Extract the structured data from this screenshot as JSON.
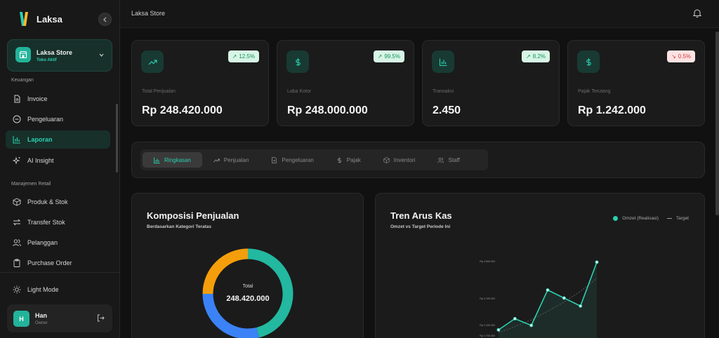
{
  "brand": {
    "name": "Laksa"
  },
  "store": {
    "name": "Laksa Store",
    "subtitle": "Toko Aktif"
  },
  "sidebar": {
    "sections": [
      {
        "label": "Keuangan"
      },
      {
        "label": "Manajemen Retail"
      }
    ],
    "items": [
      {
        "label": "Invoice",
        "icon": "file-text-icon"
      },
      {
        "label": "Pengeluaran",
        "icon": "minus-circle-icon"
      },
      {
        "label": "Laporan",
        "icon": "bar-chart-icon",
        "active": true
      },
      {
        "label": "AI Insight",
        "icon": "sparkles-icon"
      },
      {
        "label": "Produk & Stok",
        "icon": "box-icon"
      },
      {
        "label": "Transfer Stok",
        "icon": "transfer-icon"
      },
      {
        "label": "Pelanggan",
        "icon": "users-icon"
      },
      {
        "label": "Purchase Order",
        "icon": "clipboard-icon"
      }
    ],
    "theme_toggle": "Light Mode"
  },
  "user": {
    "initial": "H",
    "name": "Han",
    "role": "Owner"
  },
  "topbar": {
    "title": "Laksa Store"
  },
  "kpis": [
    {
      "label": "Total Penjualan",
      "value": "Rp 248.420.000",
      "change": "12.5%",
      "trend": "up",
      "icon": "trending-up-icon"
    },
    {
      "label": "Laba Kotor",
      "value": "Rp 248.000.000",
      "change": "99.5%",
      "trend": "up",
      "icon": "dollar-icon"
    },
    {
      "label": "Transaksi",
      "value": "2.450",
      "change": "8.2%",
      "trend": "up",
      "icon": "bar-chart-icon"
    },
    {
      "label": "Pajak Terutang",
      "value": "Rp 1.242.000",
      "change": "0.5%",
      "trend": "down",
      "icon": "dollar-icon"
    }
  ],
  "tabs": [
    {
      "label": "Ringkasan",
      "active": true,
      "icon": "bar-chart-icon"
    },
    {
      "label": "Penjualan",
      "icon": "trending-up-icon"
    },
    {
      "label": "Pengeluaran",
      "icon": "file-text-icon"
    },
    {
      "label": "Pajak",
      "icon": "dollar-icon"
    },
    {
      "label": "Inventori",
      "icon": "box-icon"
    },
    {
      "label": "Staff",
      "icon": "users-icon"
    }
  ],
  "donut": {
    "title": "Komposisi Penjualan",
    "subtitle": "Berdasarkan Kategori Teratas",
    "center_label": "Total",
    "center_value": "248.420.000"
  },
  "cashflow": {
    "title": "Tren Arus Kas",
    "subtitle": "Omzet vs Target Periode Ini",
    "legend_actual": "Omzet (Realisasi)",
    "legend_target": "Target"
  },
  "colors": {
    "accent": "#2bd0b0",
    "blue": "#3b82f6",
    "orange": "#f59e0b"
  },
  "chart_data": [
    {
      "type": "pie",
      "title": "Komposisi Penjualan",
      "slices": [
        {
          "color": "#23b8a0",
          "value": 46
        },
        {
          "color": "#3b82f6",
          "value": 29
        },
        {
          "color": "#f59e0b",
          "value": 25
        }
      ]
    },
    {
      "type": "line",
      "title": "Tren Arus Kas",
      "y_ticks": [
        "Rp 1.700.000",
        "Rp 2.100.000",
        "Rp 3.100.000",
        "Rp 4.500.000"
      ],
      "ylim": [
        1700000,
        4500000
      ],
      "series": [
        {
          "name": "Omzet (Realisasi)",
          "values": [
            1900000,
            2320000,
            2070000,
            3400000,
            3100000,
            2800000,
            4450000
          ]
        },
        {
          "name": "Target",
          "values": [
            1800000,
            2020000,
            2280000,
            2600000,
            2950000,
            3350000,
            3850000
          ]
        }
      ]
    }
  ]
}
